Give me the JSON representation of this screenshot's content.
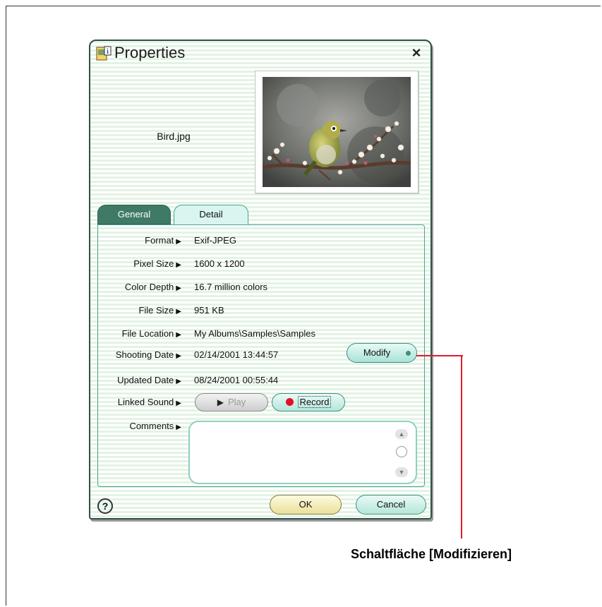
{
  "dialog": {
    "title": "Properties",
    "close_label": "×",
    "filename": "Bird.jpg",
    "tabs": [
      {
        "label": "General",
        "active": true
      },
      {
        "label": "Detail",
        "active": false
      }
    ],
    "properties": [
      {
        "label": "Format",
        "value": "Exif-JPEG"
      },
      {
        "label": "Pixel Size",
        "value": "1600 x 1200"
      },
      {
        "label": "Color Depth",
        "value": "16.7 million colors"
      },
      {
        "label": "File Size",
        "value": "951 KB"
      },
      {
        "label": "File Location",
        "value": "My Albums\\Samples\\Samples"
      },
      {
        "label": "Shooting Date",
        "value": "02/14/2001 13:44:57"
      },
      {
        "label": "Updated Date",
        "value": "08/24/2001 00:55:44"
      },
      {
        "label": "Linked Sound",
        "value": ""
      },
      {
        "label": "Comments",
        "value": ""
      }
    ],
    "modify_label": "Modify",
    "play_label": "Play",
    "record_label": "Record",
    "comments_value": "",
    "help_label": "?",
    "ok_label": "OK",
    "cancel_label": "Cancel"
  },
  "icons": {
    "title": "properties-icon",
    "close": "close-icon",
    "play": "play-icon",
    "record": "record-dot-icon",
    "scroll_up": "chevron-up-icon",
    "scroll_down": "chevron-down-icon",
    "help": "help-icon"
  },
  "colors": {
    "accent": "#3f7a66",
    "callout": "#e11b2a",
    "ok_button": "#e9df98",
    "record_dot": "#e0102a"
  },
  "annotation": {
    "caption": "Schaltfläche [Modifizieren]"
  }
}
